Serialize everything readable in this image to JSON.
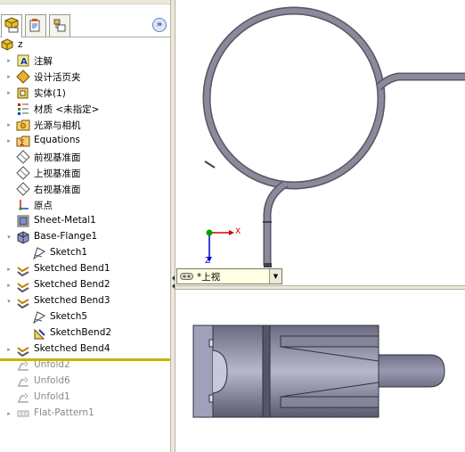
{
  "tabs": [
    {
      "icon": "feature-manager-icon",
      "active": true
    },
    {
      "icon": "property-manager-icon",
      "active": false
    },
    {
      "icon": "configuration-manager-icon",
      "active": false
    }
  ],
  "collapse_glyph": "»",
  "tree": {
    "root": "z",
    "items": [
      {
        "label": "注解",
        "icon": "annotations-icon",
        "expander": true
      },
      {
        "label": "设计活页夹",
        "icon": "design-binder-icon",
        "expander": true
      },
      {
        "label": "实体(1)",
        "icon": "solid-bodies-icon",
        "expander": true
      },
      {
        "label": "材质 <未指定>",
        "icon": "material-icon",
        "expander": false
      },
      {
        "label": "光源与相机",
        "icon": "lights-cameras-icon",
        "expander": true
      },
      {
        "label": "Equations",
        "icon": "equations-icon",
        "expander": true
      },
      {
        "label": "前视基准面",
        "icon": "plane-icon",
        "expander": false
      },
      {
        "label": "上视基准面",
        "icon": "plane-icon",
        "expander": false
      },
      {
        "label": "右视基准面",
        "icon": "plane-icon",
        "expander": false
      },
      {
        "label": "原点",
        "icon": "origin-icon",
        "expander": false
      },
      {
        "label": "Sheet-Metal1",
        "icon": "sheet-metal-icon",
        "expander": false
      },
      {
        "label": "Base-Flange1",
        "icon": "base-flange-icon",
        "expander": true,
        "open": true
      },
      {
        "label": "Sketch1",
        "icon": "sketch-icon",
        "expander": false,
        "indent": 1
      },
      {
        "label": "Sketched Bend1",
        "icon": "sketched-bend-icon",
        "expander": true
      },
      {
        "label": "Sketched Bend2",
        "icon": "sketched-bend-icon",
        "expander": true
      },
      {
        "label": "Sketched Bend3",
        "icon": "sketched-bend-icon",
        "expander": true,
        "open": true
      },
      {
        "label": "Sketch5",
        "icon": "sketch-icon",
        "expander": false,
        "indent": 1
      },
      {
        "label": "SketchBend2",
        "icon": "sketch-bend-icon",
        "expander": false,
        "indent": 1
      },
      {
        "label": "Sketched Bend4",
        "icon": "sketched-bend-icon",
        "expander": true
      },
      {
        "label": "Unfold2",
        "icon": "unfold-icon",
        "expander": false,
        "suppressed": true
      },
      {
        "label": "Unfold6",
        "icon": "unfold-icon",
        "expander": false,
        "suppressed": true
      },
      {
        "label": "Unfold1",
        "icon": "unfold-icon",
        "expander": false,
        "suppressed": true
      },
      {
        "label": "Flat-Pattern1",
        "icon": "flat-pattern-icon",
        "expander": true,
        "suppressed": true
      }
    ]
  },
  "view": {
    "name": "*上视",
    "triad_x": "X",
    "triad_z": "Z"
  },
  "colors": {
    "part_gray": "#7a7a8c",
    "part_light": "#c8c8d8",
    "triad_x": "#d40000",
    "triad_y": "#00a000",
    "triad_z": "#0000c8",
    "rollback": "#c9b500"
  }
}
